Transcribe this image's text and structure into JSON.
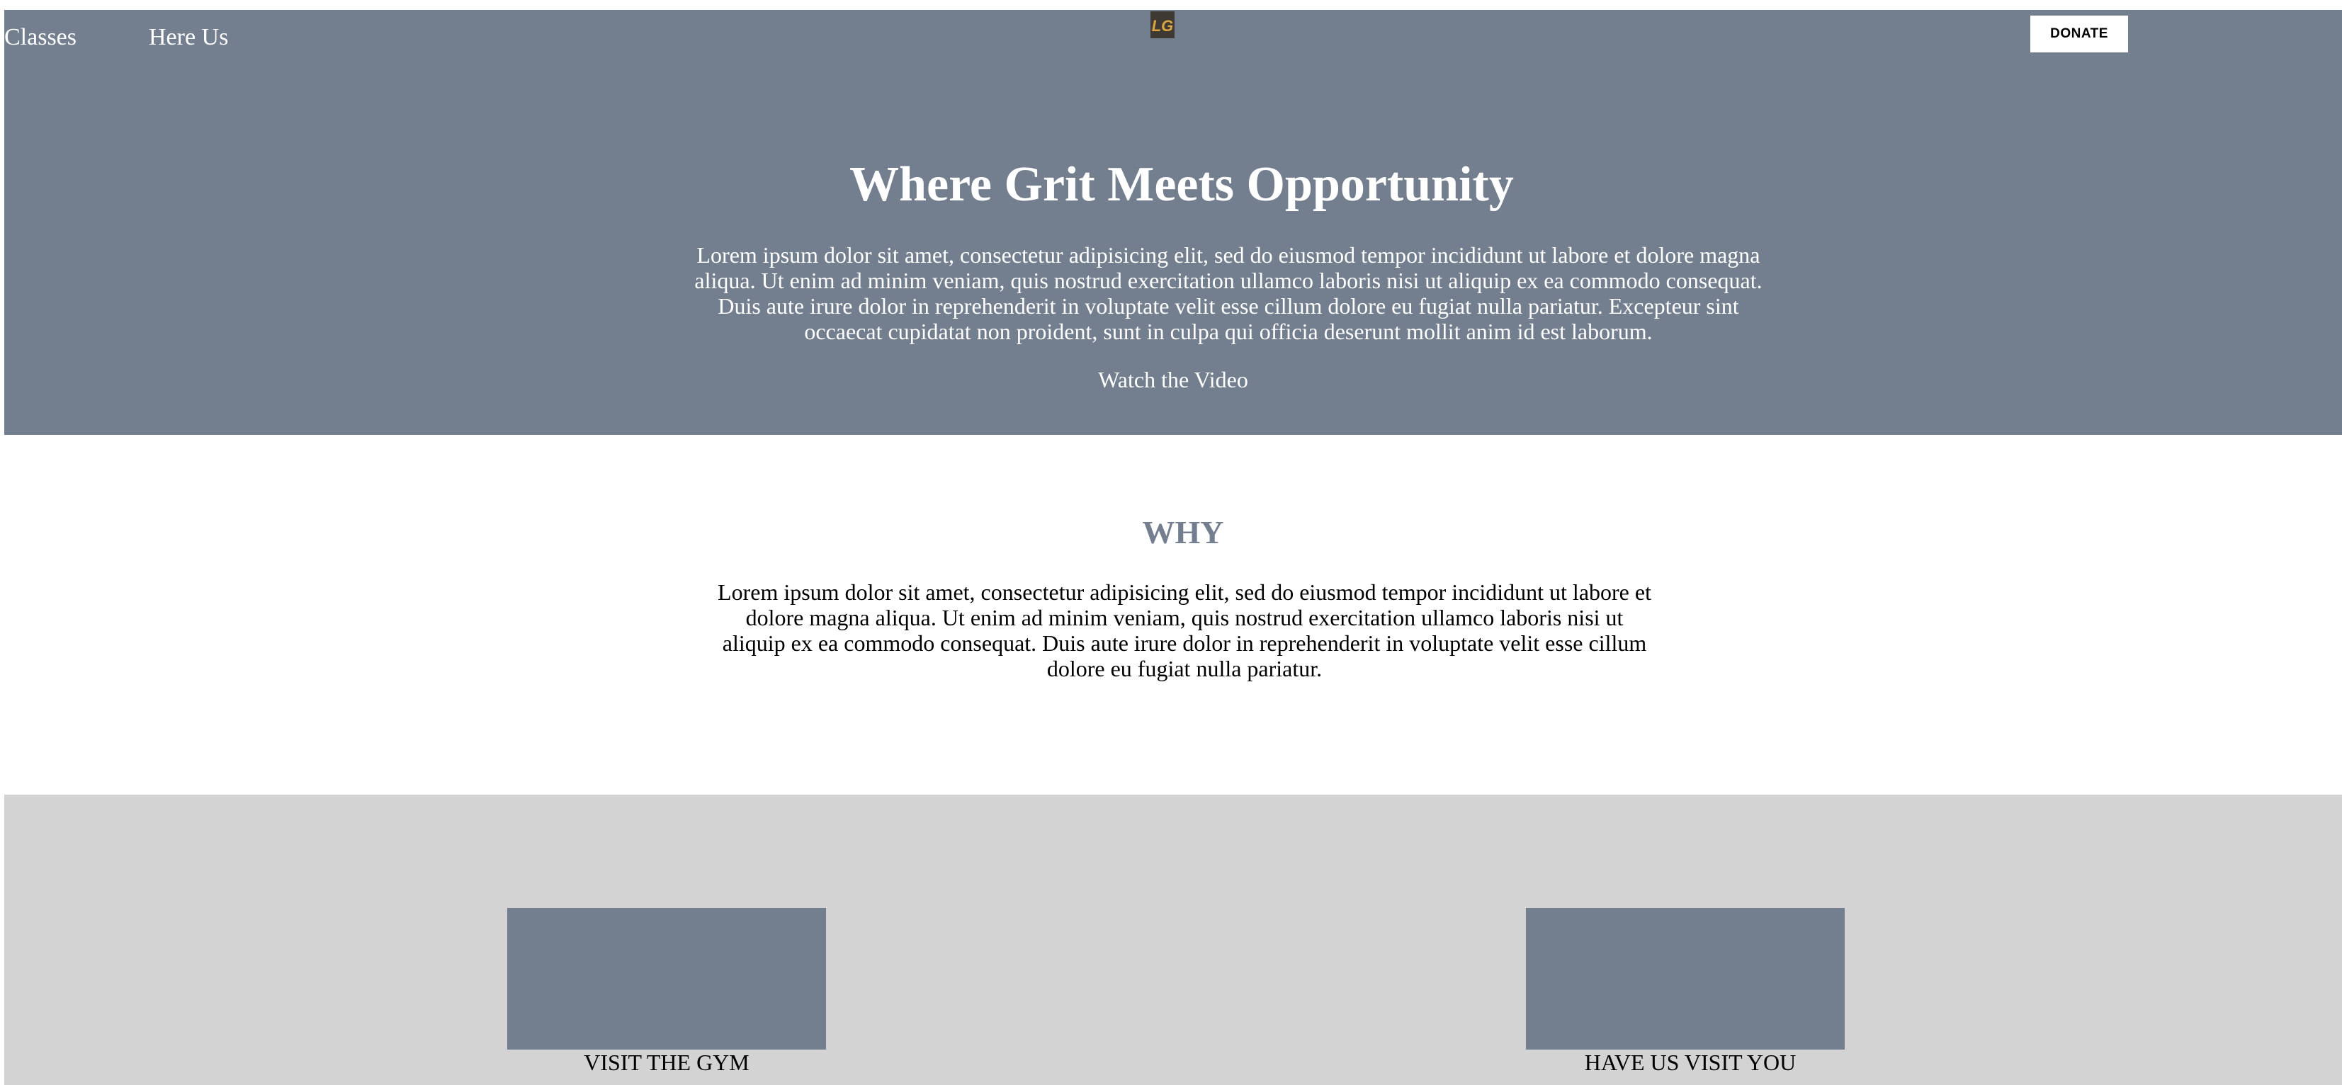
{
  "nav": {
    "links": [
      "Classes",
      "Here Us"
    ],
    "donate_label": "DONATE",
    "logo_text": "LG"
  },
  "hero": {
    "title": "Where Grit Meets Opportunity",
    "text": "Lorem ipsum dolor sit amet, consectetur adipisicing elit, sed do eiusmod tempor incididunt ut labore et dolore magna aliqua. Ut enim ad minim veniam, quis nostrud exercitation ullamco laboris nisi ut aliquip ex ea commodo consequat. Duis aute irure dolor in reprehenderit in voluptate velit esse cillum dolore eu fugiat nulla pariatur. Excepteur sint occaecat cupidatat non proident, sunt in culpa qui officia deserunt mollit anim id est laborum.",
    "video_label": "Watch the Video"
  },
  "why": {
    "title": "WHY",
    "text": "Lorem ipsum dolor sit amet, consectetur adipisicing elit, sed do eiusmod tempor incididunt ut labore et dolore magna aliqua. Ut enim ad minim veniam, quis nostrud exercitation ullamco laboris nisi ut aliquip ex ea commodo consequat. Duis aute irure dolor in reprehenderit in voluptate velit esse cillum dolore eu fugiat nulla pariatur."
  },
  "cards": [
    {
      "label": "VISIT THE GYM"
    },
    {
      "label": "HAVE US VISIT YOU"
    }
  ],
  "colors": {
    "hero_bg": "#737f8e",
    "bottom_bg": "#d3d3d3",
    "accent": "#737f8e",
    "logo_bg": "#3e3a33",
    "logo_fg": "#d9a441"
  }
}
